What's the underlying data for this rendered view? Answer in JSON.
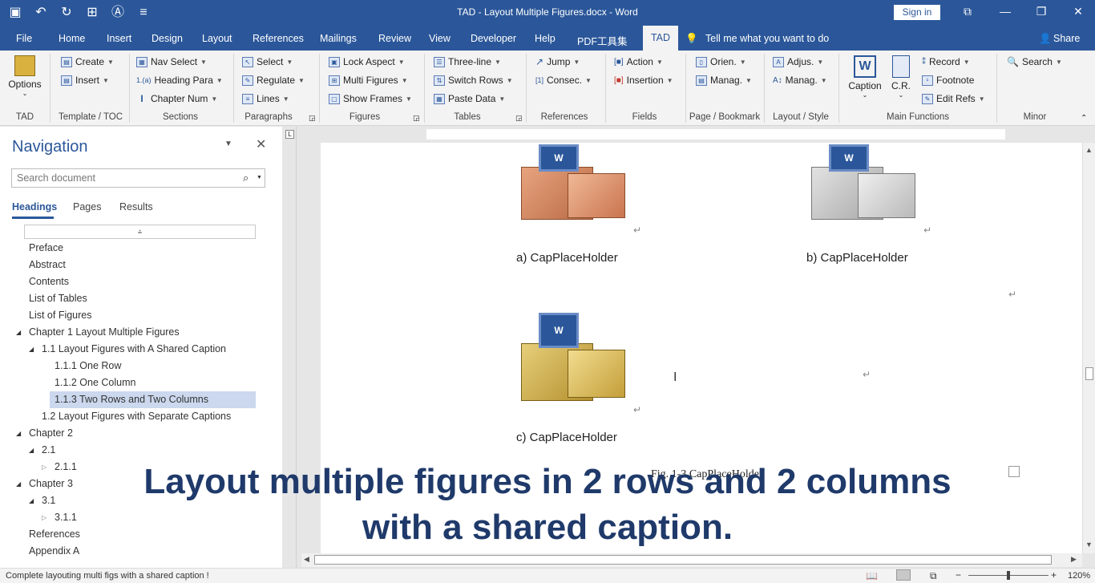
{
  "window": {
    "title": "TAD - Layout Multiple Figures.docx  -  Word",
    "sign_in": "Sign in"
  },
  "menu": [
    "File",
    "Home",
    "Insert",
    "Design",
    "Layout",
    "References",
    "Mailings",
    "Review",
    "View",
    "Developer",
    "Help",
    "PDF工具集",
    "TAD"
  ],
  "tell_me": "Tell me what you want to do",
  "share": "Share",
  "ribbon": {
    "options": "Options",
    "create": "Create",
    "insert": "Insert",
    "nav_select": "Nav Select",
    "heading_para": "Heading Para",
    "chapter_num": "Chapter Num",
    "select": "Select",
    "regulate": "Regulate",
    "lines": "Lines",
    "lock_aspect": "Lock Aspect",
    "multi_figures": "Multi Figures",
    "show_frames": "Show Frames",
    "three_line": "Three-line",
    "switch_rows": "Switch Rows",
    "paste_data": "Paste Data",
    "jump": "Jump",
    "consec": "Consec.",
    "action": "Action",
    "insertion": "Insertion",
    "orien": "Orien.",
    "manag1": "Manag.",
    "adjus": "Adjus.",
    "manag2": "Manag.",
    "caption": "Caption",
    "cr": "C.R.",
    "record": "Record",
    "footnote": "Footnote",
    "edit_refs": "Edit Refs",
    "search": "Search",
    "groups": [
      "TAD",
      "Template / TOC",
      "Sections",
      "Paragraphs",
      "Figures",
      "Tables",
      "References",
      "Fields",
      "Page / Bookmark",
      "Layout / Style",
      "Main Functions",
      "Minor"
    ]
  },
  "navigation": {
    "title": "Navigation",
    "search_placeholder": "Search document",
    "tabs": [
      "Headings",
      "Pages",
      "Results"
    ],
    "items": [
      "Preface",
      "Abstract",
      "Contents",
      "List of Tables",
      "List of Figures",
      "Chapter 1 Layout Multiple Figures",
      "1.1 Layout Figures with A Shared Caption",
      "1.1.1 One Row",
      "1.1.2 One Column",
      "1.1.3 Two Rows and Two Columns",
      "1.2 Layout Figures with Separate Captions",
      "Chapter 2",
      "2.1",
      "2.1.1",
      "Chapter 3",
      "3.1",
      "3.1.1",
      "References",
      "Appendix A"
    ]
  },
  "document": {
    "caption_a": "a) CapPlaceHolder",
    "caption_b": "b) CapPlaceHolder",
    "caption_c": "c) CapPlaceHolder",
    "fig_caption": "Fig. 1-3 CapPlaceHolder"
  },
  "overlay": {
    "line1": "Layout multiple figures in 2 rows and 2 columns",
    "line2": "with a shared caption."
  },
  "status": {
    "message": "Complete layouting multi figs with a shared caption !",
    "zoom": "120%"
  },
  "colors": {
    "accent": "#2b579a",
    "selection": "#cbd8ee",
    "overlay_text": "#1f3a6a"
  }
}
